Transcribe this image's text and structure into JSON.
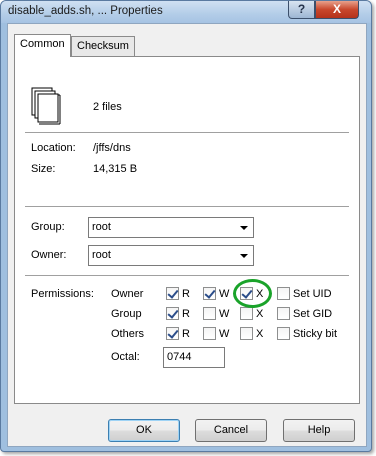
{
  "window": {
    "title": "disable_adds.sh, ... Properties",
    "help_glyph": "?",
    "close_glyph": "X"
  },
  "tabs": [
    {
      "label": "Common",
      "active": true
    },
    {
      "label": "Checksum",
      "active": false
    }
  ],
  "info": {
    "file_count": "2 files",
    "location_label": "Location:",
    "location_value": "/jffs/dns",
    "size_label": "Size:",
    "size_value": "14,315 B"
  },
  "ownership": {
    "group_label": "Group:",
    "group_value": "root",
    "owner_label": "Owner:",
    "owner_value": "root"
  },
  "permissions": {
    "label": "Permissions:",
    "rows": [
      {
        "name": "Owner",
        "r": true,
        "w": true,
        "x": true,
        "special_label": "Set UID",
        "special": false
      },
      {
        "name": "Group",
        "r": true,
        "w": false,
        "x": false,
        "special_label": "Set GID",
        "special": false
      },
      {
        "name": "Others",
        "r": true,
        "w": false,
        "x": false,
        "special_label": "Sticky bit",
        "special": false
      }
    ],
    "r_label": "R",
    "w_label": "W",
    "x_label": "X",
    "octal_label": "Octal:",
    "octal_value": "0744"
  },
  "buttons": {
    "ok": "OK",
    "cancel": "Cancel",
    "help": "Help"
  },
  "colors": {
    "highlight_circle": "#1aa32a"
  }
}
